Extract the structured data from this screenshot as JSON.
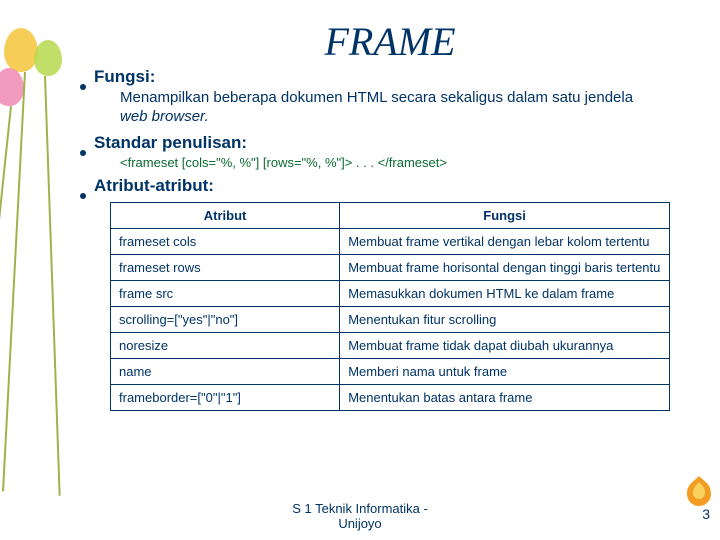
{
  "title": "FRAME",
  "sections": {
    "fungsi": {
      "label": "Fungsi:",
      "desc_part1": "Menampilkan beberapa dokumen HTML secara sekaligus dalam satu jendela ",
      "desc_italic": "web browser.",
      "desc_full": "Menampilkan beberapa dokumen HTML secara sekaligus dalam satu jendela web browser."
    },
    "standar": {
      "label": "Standar penulisan:",
      "code": "<frameset [cols=\"%, %\"] [rows=\"%, %\"]> . . . </frameset>"
    },
    "atribut": {
      "label": "Atribut-atribut:"
    }
  },
  "table": {
    "headers": {
      "col1": "Atribut",
      "col2": "Fungsi"
    },
    "rows": [
      {
        "attr": "frameset cols",
        "fungsi": "Membuat frame vertikal dengan lebar kolom tertentu"
      },
      {
        "attr": "frameset rows",
        "fungsi": "Membuat frame horisontal dengan tinggi baris tertentu"
      },
      {
        "attr": "frame src",
        "fungsi": "Memasukkan dokumen HTML ke dalam frame"
      },
      {
        "attr": "scrolling=[\"yes\"|\"no\"]",
        "fungsi": "Menentukan fitur scrolling"
      },
      {
        "attr": "noresize",
        "fungsi": "Membuat frame tidak dapat diubah ukurannya"
      },
      {
        "attr": "name",
        "fungsi": "Memberi nama untuk frame"
      },
      {
        "attr": "frameborder=[\"0\"|\"1\"]",
        "fungsi": "Menentukan batas antara frame"
      }
    ]
  },
  "footer": {
    "line1": "S 1 Teknik Informatika -",
    "line2": "Unijoyo"
  },
  "page_number": "3"
}
